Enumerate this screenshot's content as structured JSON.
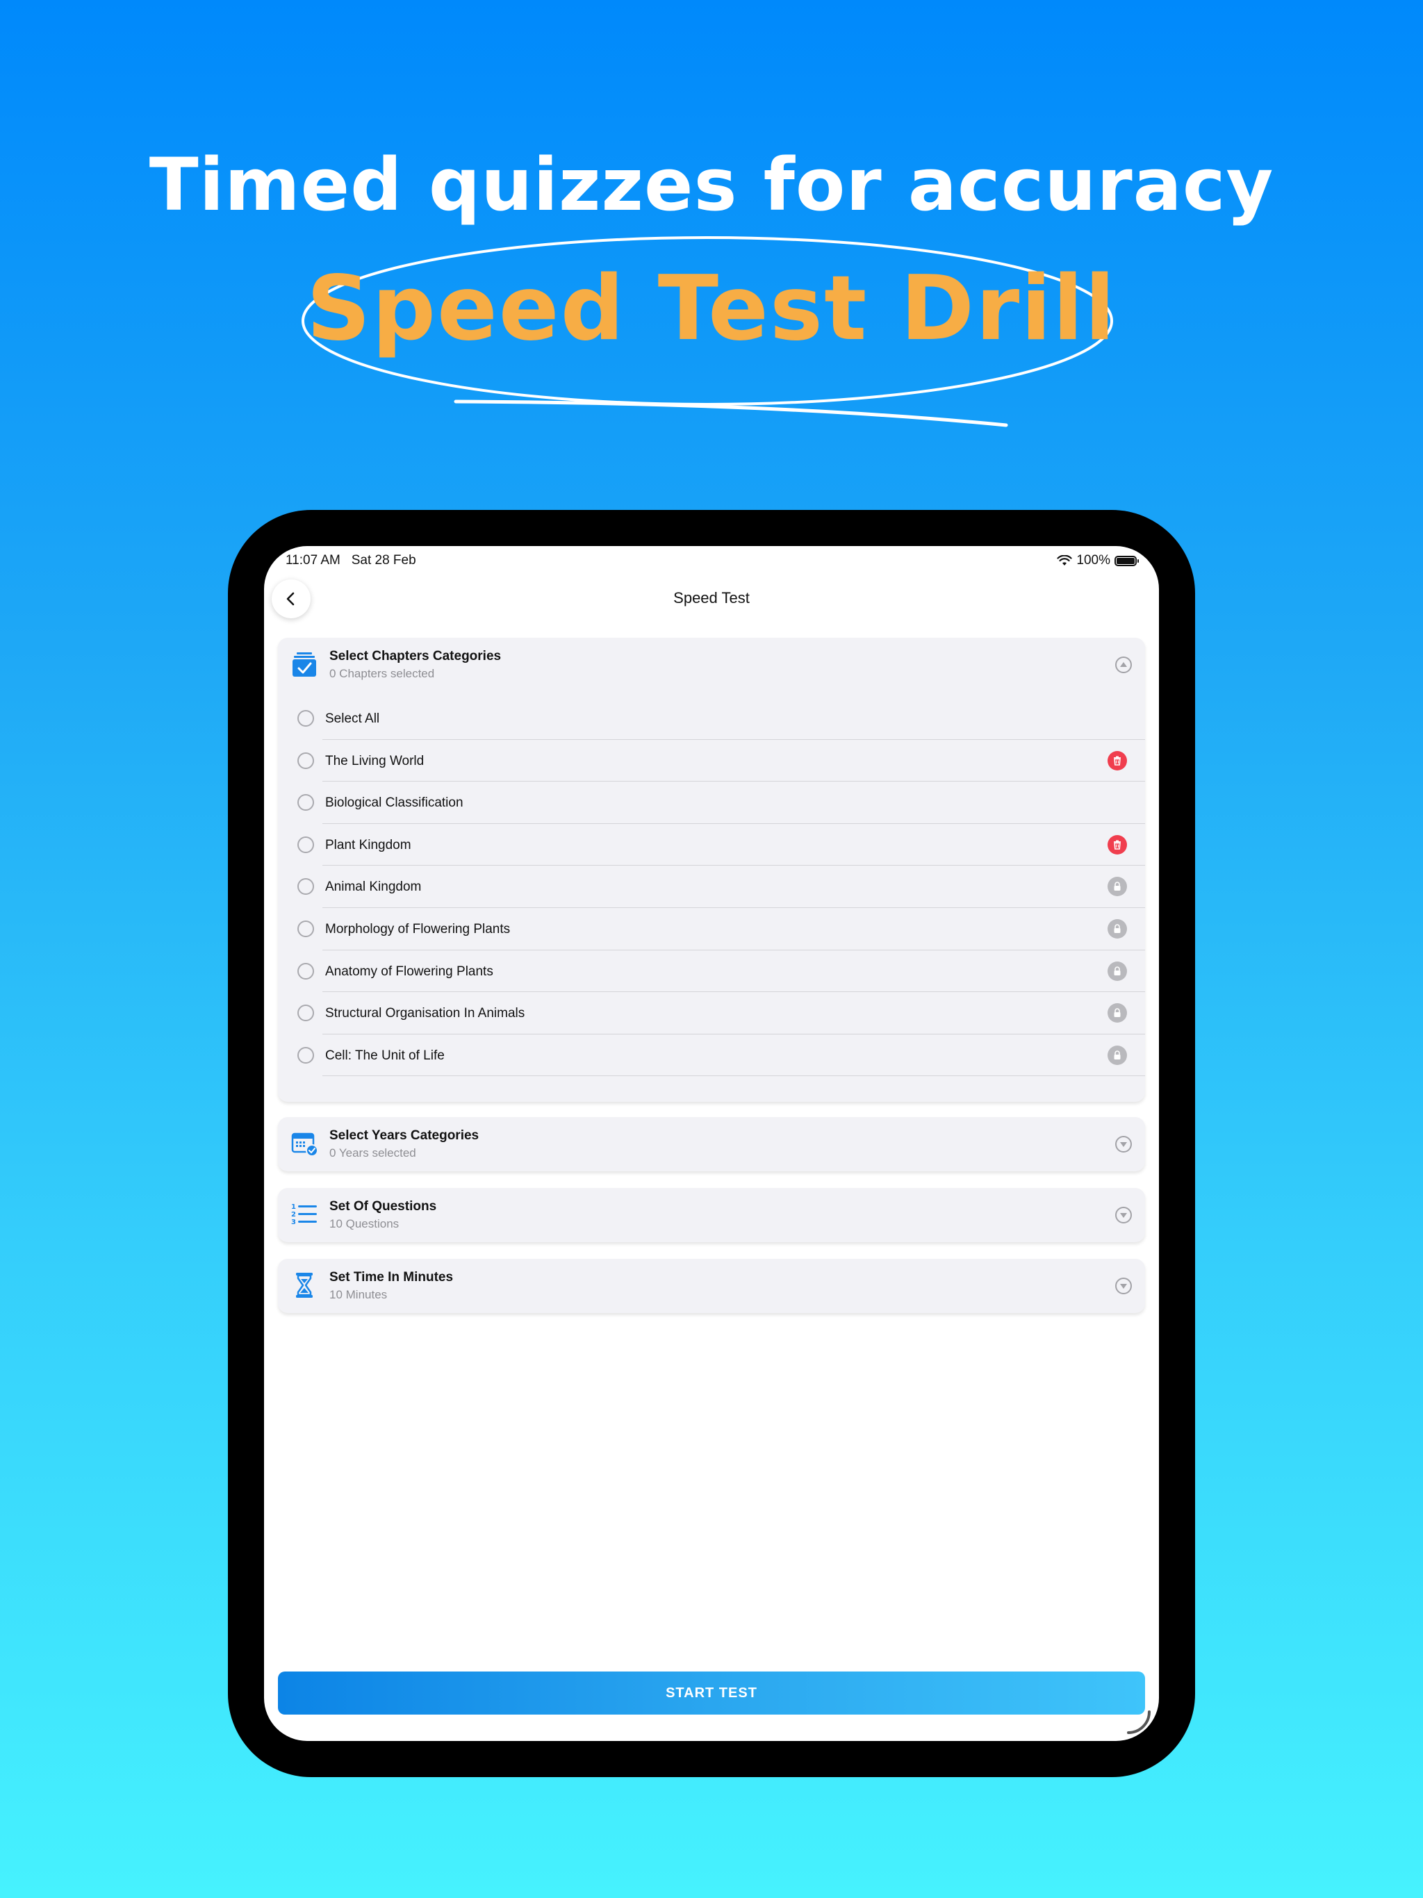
{
  "promo": {
    "headline": "Timed quizzes for accuracy",
    "subheadline": "Speed Test Drill"
  },
  "colors": {
    "background_top": "#0089fb",
    "background_bottom": "#46f2fe",
    "subheadline": "#f7ad45",
    "accent_blue": "#1a86e8",
    "delete_red": "#f03e4e",
    "lock_gray": "#b9b9bd"
  },
  "status_bar": {
    "time": "11:07 AM",
    "date": "Sat 28 Feb",
    "battery": "100%"
  },
  "nav": {
    "title": "Speed Test",
    "back_icon": "chevron-left-icon"
  },
  "chapters": {
    "title": "Select Chapters Categories",
    "subtitle": "0 Chapters selected",
    "icon": "checklist-icon",
    "expanded": true,
    "items": [
      {
        "label": "Select All",
        "badge": "none"
      },
      {
        "label": "The Living World",
        "badge": "delete"
      },
      {
        "label": "Biological Classification",
        "badge": "none"
      },
      {
        "label": "Plant Kingdom",
        "badge": "delete"
      },
      {
        "label": "Animal Kingdom",
        "badge": "lock"
      },
      {
        "label": "Morphology of Flowering Plants",
        "badge": "lock"
      },
      {
        "label": "Anatomy of Flowering Plants",
        "badge": "lock"
      },
      {
        "label": "Structural Organisation In Animals",
        "badge": "lock"
      },
      {
        "label": "Cell: The Unit of Life",
        "badge": "lock"
      }
    ]
  },
  "years": {
    "title": "Select Years Categories",
    "subtitle": "0 Years selected",
    "icon": "calendar-check-icon"
  },
  "questions": {
    "title": "Set Of Questions",
    "subtitle": "10 Questions",
    "icon": "numbered-list-icon"
  },
  "time": {
    "title": "Set Time In Minutes",
    "subtitle": "10 Minutes",
    "icon": "hourglass-icon"
  },
  "start_button": "START TEST"
}
